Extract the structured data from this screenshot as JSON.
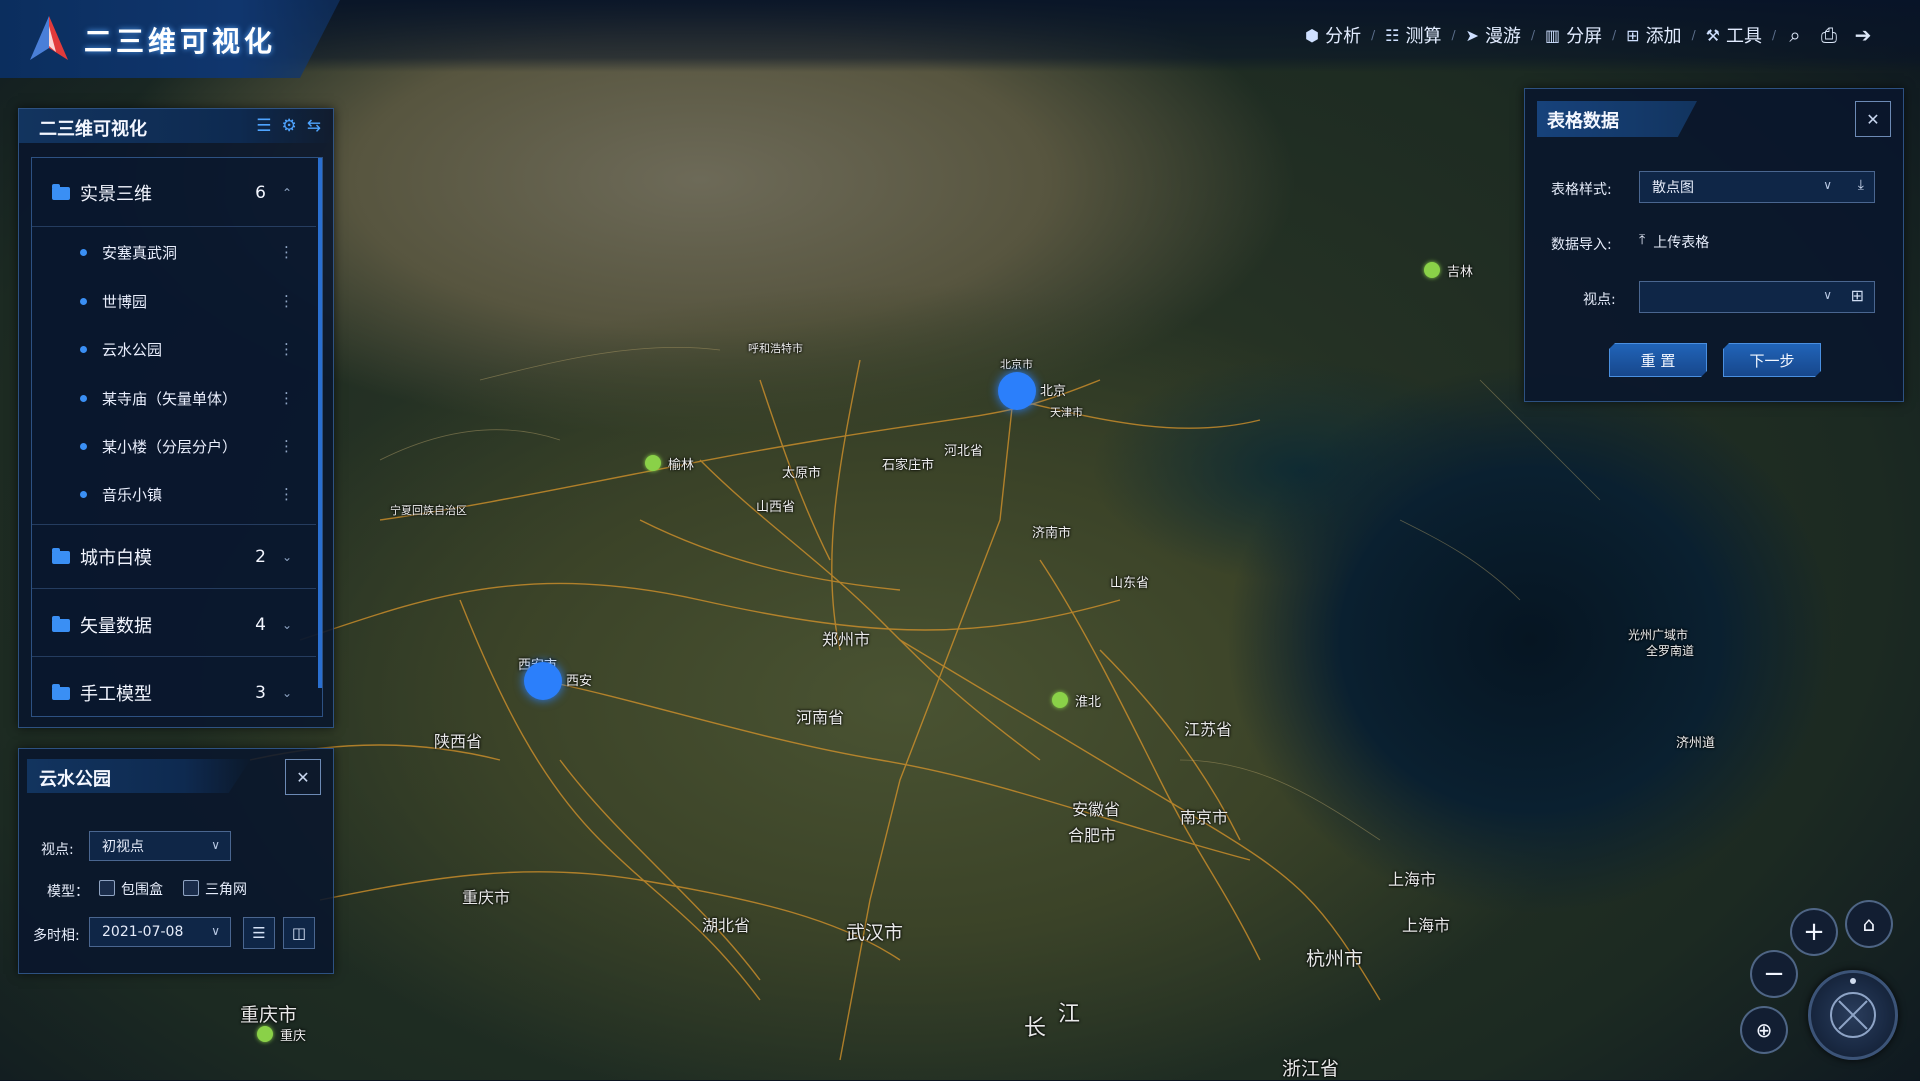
{
  "app": {
    "title": "二三维可视化"
  },
  "menu": {
    "items": [
      {
        "label": "分析",
        "icon": "cube-icon"
      },
      {
        "label": "测算",
        "icon": "measure-icon"
      },
      {
        "label": "漫游",
        "icon": "paper-plane-icon"
      },
      {
        "label": "分屏",
        "icon": "split-screen-icon"
      },
      {
        "label": "添加",
        "icon": "plus-square-icon"
      },
      {
        "label": "工具",
        "icon": "wrench-icon"
      }
    ],
    "tools": [
      "search-icon",
      "print-icon",
      "logout-icon"
    ]
  },
  "tree": {
    "title": "二三维可视化",
    "groups": [
      {
        "label": "实景三维",
        "count": "6",
        "expanded": true,
        "items": [
          "安塞真武洞",
          "世博园",
          "云水公园",
          "某寺庙（矢量单体）",
          "某小楼（分层分户）",
          "音乐小镇"
        ]
      },
      {
        "label": "城市白模",
        "count": "2",
        "expanded": false
      },
      {
        "label": "矢量数据",
        "count": "4",
        "expanded": false
      },
      {
        "label": "手工模型",
        "count": "3",
        "expanded": false
      }
    ]
  },
  "park_panel": {
    "title": "云水公园",
    "viewpoint_label": "视点:",
    "viewpoint_value": "初视点",
    "model_label": "模型：",
    "model_options": [
      "包围盒",
      "三角网"
    ],
    "timephase_label": "多时相:",
    "timephase_value": "2021-07-08"
  },
  "table_panel": {
    "title": "表格数据",
    "style_label": "表格样式:",
    "style_value": "散点图",
    "import_label": "数据导入:",
    "upload_label": "上传表格",
    "viewpoint_label": "视点:",
    "viewpoint_value": "",
    "reset_label": "重 置",
    "next_label": "下一步"
  },
  "map": {
    "markers": [
      {
        "name": "北京",
        "type": "blue"
      },
      {
        "name": "西安",
        "type": "blue"
      },
      {
        "name": "榆林",
        "type": "green"
      },
      {
        "name": "吉林",
        "type": "green"
      },
      {
        "name": "淮北",
        "type": "green"
      },
      {
        "name": "重庆",
        "type": "green"
      }
    ],
    "place_labels": [
      "北京市",
      "天津市",
      "河北省",
      "石家庄市",
      "太原市",
      "山西省",
      "济南市",
      "山东省",
      "郑州市",
      "河南省",
      "西安市",
      "陕西省",
      "江苏省",
      "安徽省",
      "合肥市",
      "南京市",
      "上海市",
      "上海市",
      "武汉市",
      "湖北省",
      "重庆市",
      "重庆市",
      "杭州市",
      "浙江省",
      "呼和浩特市",
      "宁夏回族自治区",
      "光州广域市",
      "全罗南道",
      "济州道",
      "长",
      "江"
    ],
    "colors": {
      "blue_marker": "#2b7ffb",
      "green_marker": "#8ad148",
      "road": "#d9952b"
    }
  },
  "nav": {
    "zoom_in": "+",
    "zoom_out": "−"
  }
}
